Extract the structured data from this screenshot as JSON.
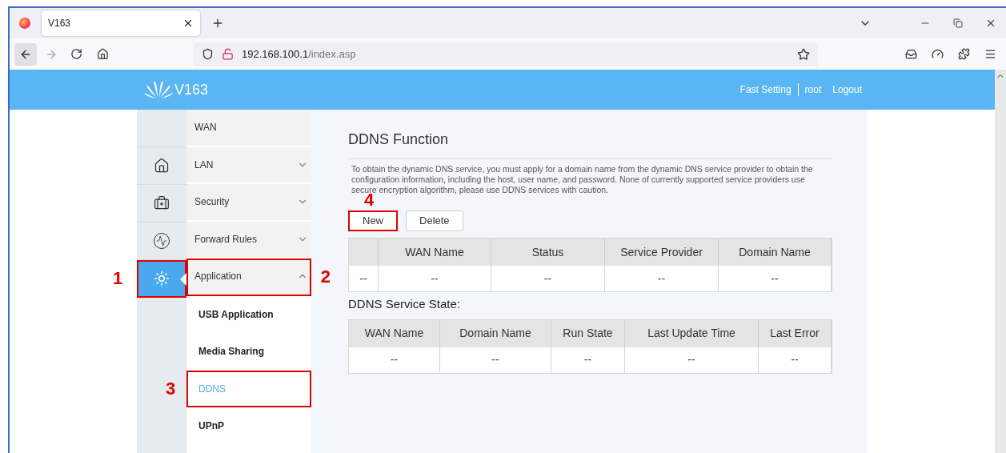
{
  "browser": {
    "tab_title": "V163",
    "url_host": "192.168.100.1",
    "url_path": "/index.asp"
  },
  "header": {
    "brand": "V163",
    "links": [
      {
        "label": "Fast Setting"
      },
      {
        "label": "root"
      },
      {
        "label": "Logout"
      }
    ]
  },
  "icon_rail": [
    {
      "kind": "blank",
      "selected": false
    },
    {
      "kind": "home",
      "selected": false
    },
    {
      "kind": "kit",
      "selected": false
    },
    {
      "kind": "pulse",
      "selected": false
    },
    {
      "kind": "gear",
      "selected": true,
      "callout": "1"
    }
  ],
  "menu": [
    {
      "kind": "group",
      "label": "WAN"
    },
    {
      "kind": "group",
      "label": "LAN",
      "expanded": false
    },
    {
      "kind": "group",
      "label": "Security",
      "expanded": false
    },
    {
      "kind": "group",
      "label": "Forward Rules",
      "expanded": false
    },
    {
      "kind": "group",
      "label": "Application",
      "expanded": true,
      "callout": "2"
    },
    {
      "kind": "sub",
      "label": "USB Application",
      "selected": false
    },
    {
      "kind": "sub",
      "label": "Media Sharing",
      "selected": false
    },
    {
      "kind": "sub",
      "label": "DDNS",
      "selected": true,
      "callout": "3"
    },
    {
      "kind": "sub",
      "label": "UPnP",
      "selected": false
    }
  ],
  "content": {
    "title": "DDNS Function",
    "description": "To obtain the dynamic DNS service, you must apply for a domain name from the dynamic DNS service provider to obtain the configuration information, including the host, user name, and password. None of currently supported service providers use secure encryption algorithm, please use DDNS services with caution.",
    "buttons": [
      {
        "label": "New",
        "callout": "4"
      },
      {
        "label": "Delete"
      }
    ],
    "table": {
      "columns": [
        "",
        "WAN Name",
        "Status",
        "Service Provider",
        "Domain Name"
      ],
      "rows": [
        [
          "--",
          "--",
          "--",
          "--",
          "--"
        ]
      ]
    },
    "state_title": "DDNS Service State:",
    "state_table": {
      "columns": [
        "WAN Name",
        "Domain Name",
        "Run State",
        "Last Update Time",
        "Last Error"
      ],
      "rows": [
        [
          "--",
          "--",
          "--",
          "--",
          "--"
        ]
      ]
    }
  }
}
